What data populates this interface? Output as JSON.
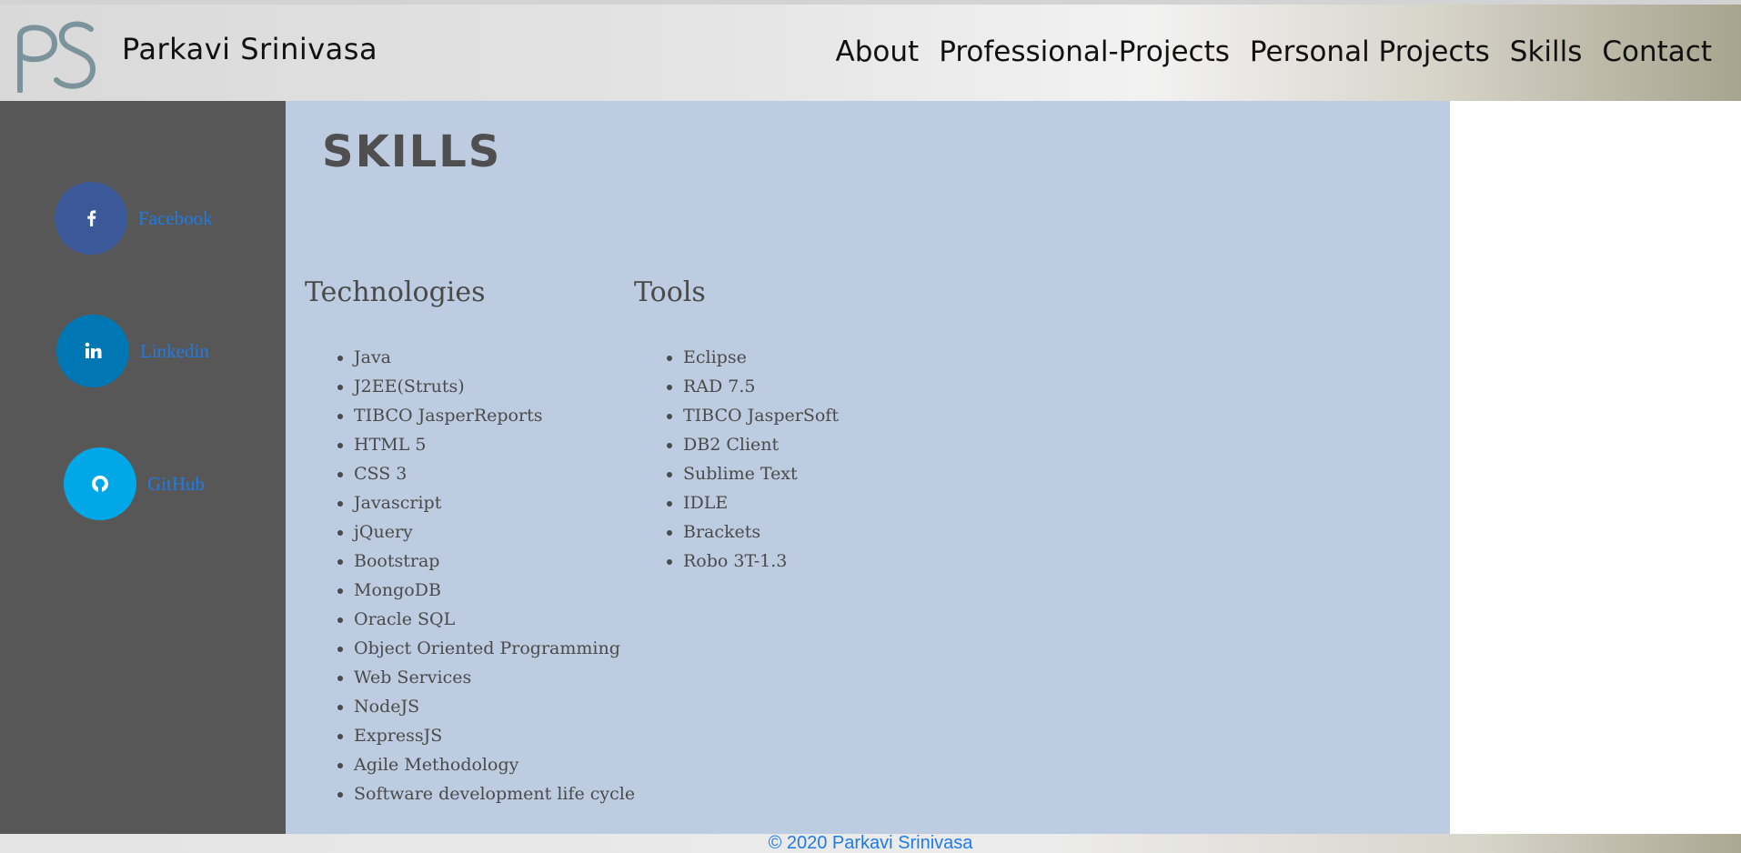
{
  "header": {
    "logo_text": "PS",
    "site_name": "Parkavi Srinivasa",
    "nav": [
      {
        "label": "About"
      },
      {
        "label": "Professional-Projects"
      },
      {
        "label": "Personal Projects"
      },
      {
        "label": "Skills"
      },
      {
        "label": "Contact"
      }
    ]
  },
  "sidebar": {
    "social": [
      {
        "label": "Facebook",
        "icon": "facebook-icon",
        "color": "#3b5998"
      },
      {
        "label": "Linkedin",
        "icon": "linkedin-icon",
        "color": "#0077b5"
      },
      {
        "label": "GitHub",
        "icon": "github-icon",
        "color": "#00a8e8"
      }
    ]
  },
  "main": {
    "title": "SKILLS",
    "technologies": {
      "heading": "Technologies",
      "items": [
        "Java",
        "J2EE(Struts)",
        "TIBCO JasperReports",
        "HTML 5",
        "CSS 3",
        "Javascript",
        "jQuery",
        "Bootstrap",
        "MongoDB",
        "Oracle SQL",
        "Object Oriented Programming",
        "Web Services",
        "NodeJS",
        "ExpressJS",
        "Agile Methodology",
        "Software development life cycle"
      ]
    },
    "tools": {
      "heading": "Tools",
      "items": [
        "Eclipse",
        "RAD 7.5",
        "TIBCO JasperSoft",
        "DB2 Client",
        "Sublime Text",
        "IDLE",
        "Brackets",
        "Robo 3T-1.3"
      ]
    }
  },
  "footer": {
    "copyright": "© 2020 Parkavi Srinivasa"
  },
  "colors": {
    "sidebar_bg": "#575757",
    "main_bg": "#bdcce0",
    "link": "#1f7be8"
  }
}
